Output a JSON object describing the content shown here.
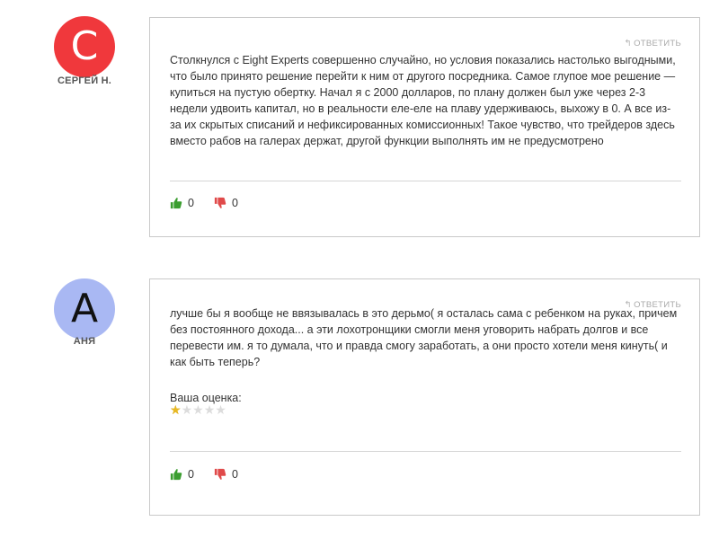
{
  "comments": [
    {
      "avatar_letter": "C",
      "avatar_color": "#f0383c",
      "author": "СЕРГЕЙ Н.",
      "reply_label": "ОТВЕТИТЬ",
      "text": "Столкнулся с Eight Experts совершенно случайно, но условия показались настолько выгодными, что было принято решение перейти к ним от другого посредника. Самое глупое мое решение — купиться на пустую обертку. Начал я с 2000 долларов, по плану должен был уже через 2-3 недели удвоить капитал, но в реальности еле-еле на плаву удерживаюсь, выхожу в 0. А все из-за их скрытых списаний и нефиксированных комиссионных! Такое чувство, что трейдеров здесь вместо рабов на галерах держат, другой функции выполнять им не предусмотрено",
      "likes": "0",
      "dislikes": "0"
    },
    {
      "avatar_letter": "A",
      "avatar_color": "#a9b8f3",
      "author": "АНЯ",
      "reply_label": "ОТВЕТИТЬ",
      "text": "лучше бы я вообще не ввязывалась в это дерьмо( я осталась сама с ребенком на руках, причем без постоянного дохода... а эти лохотронщики смогли меня уговорить набрать долгов и все перевести им. я то думала, что и правда смогу заработать, а они просто хотели меня кинуть( и как быть теперь?",
      "rating_label": "Ваша оценка:",
      "rating": 1,
      "rating_max": 5,
      "likes": "0",
      "dislikes": "0"
    }
  ],
  "colors": {
    "like": "#3a9d2f",
    "dislike": "#e04a4a",
    "star_filled": "#e8b923",
    "star_empty": "#dcdcdc"
  }
}
